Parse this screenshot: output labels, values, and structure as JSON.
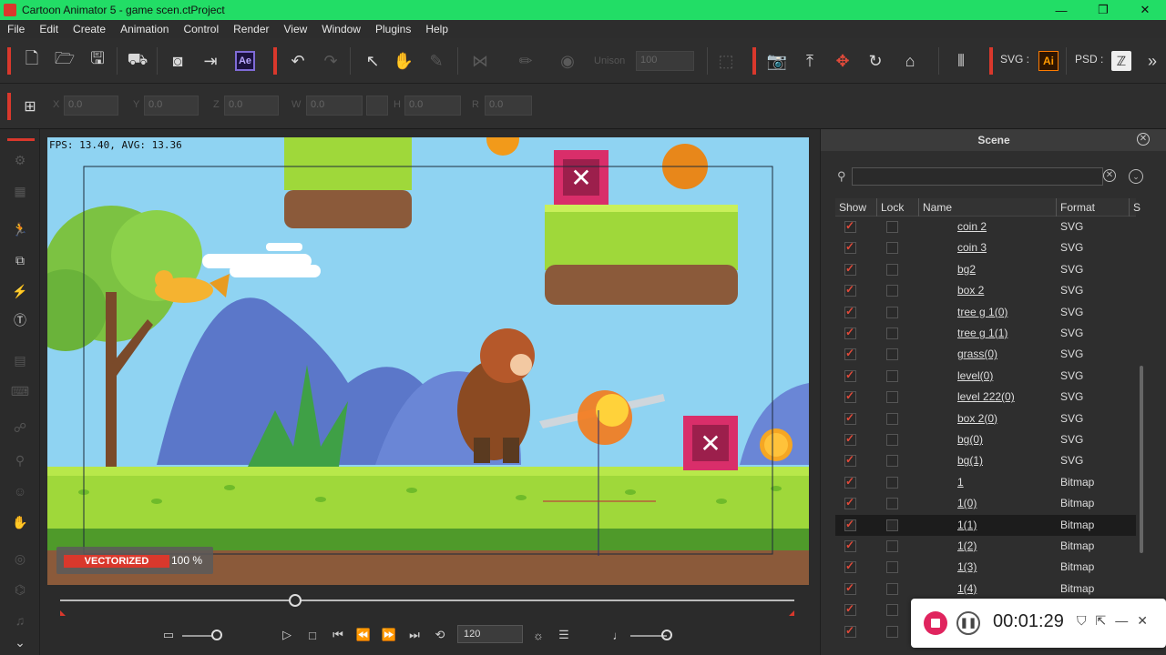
{
  "window": {
    "title": "Cartoon Animator 5 - game scen.ctProject",
    "minimize": "—",
    "restore": "❐",
    "close": "✕"
  },
  "menu": [
    "File",
    "Edit",
    "Create",
    "Animation",
    "Control",
    "Render",
    "View",
    "Window",
    "Plugins",
    "Help"
  ],
  "toolbar": {
    "ae_label": "Ae",
    "svg_label": "SVG :",
    "ai_label": "Ai",
    "psd_label": "PSD :",
    "unison_label": "Unison",
    "unison_value": "100",
    "more": "»"
  },
  "transform": {
    "x_label": "X",
    "x_value": "0.0",
    "y_label": "Y",
    "y_value": "0.0",
    "z_label": "Z",
    "z_value": "0.0",
    "w_label": "W",
    "w_value": "0.0",
    "h_label": "H",
    "h_value": "0.0",
    "r_label": "R",
    "r_value": "0.0"
  },
  "viewport": {
    "fps_text": "FPS: 13.40, AVG: 13.36",
    "vectorized_label": "VECTORIZED",
    "vectorized_percent": "100 %",
    "vectorized_progress": 1.0
  },
  "timeline": {
    "frames": "120",
    "playhead_fraction": 0.32
  },
  "scene_panel": {
    "title": "Scene",
    "search_placeholder": "",
    "columns": {
      "show": "Show",
      "lock": "Lock",
      "name": "Name",
      "format": "Format",
      "extra": "S"
    },
    "rows": [
      {
        "name": "coin 2",
        "format": "SVG",
        "show": true,
        "selected": false
      },
      {
        "name": "coin 3",
        "format": "SVG",
        "show": true,
        "selected": false
      },
      {
        "name": "bg2",
        "format": "SVG",
        "show": true,
        "selected": false
      },
      {
        "name": "box 2",
        "format": "SVG",
        "show": true,
        "selected": false
      },
      {
        "name": "tree g 1(0)",
        "format": "SVG",
        "show": true,
        "selected": false
      },
      {
        "name": "tree g 1(1)",
        "format": "SVG",
        "show": true,
        "selected": false
      },
      {
        "name": "grass(0)",
        "format": "SVG",
        "show": true,
        "selected": false
      },
      {
        "name": "level(0)",
        "format": "SVG",
        "show": true,
        "selected": false
      },
      {
        "name": "level 222(0)",
        "format": "SVG",
        "show": true,
        "selected": false
      },
      {
        "name": "box 2(0)",
        "format": "SVG",
        "show": true,
        "selected": false
      },
      {
        "name": "bg(0)",
        "format": "SVG",
        "show": true,
        "selected": false
      },
      {
        "name": "bg(1)",
        "format": "SVG",
        "show": true,
        "selected": false
      },
      {
        "name": "1",
        "format": "Bitmap",
        "show": true,
        "selected": false
      },
      {
        "name": "1(0)",
        "format": "Bitmap",
        "show": true,
        "selected": false
      },
      {
        "name": "1(1)",
        "format": "Bitmap",
        "show": true,
        "selected": true
      },
      {
        "name": "1(2)",
        "format": "Bitmap",
        "show": true,
        "selected": false
      },
      {
        "name": "1(3)",
        "format": "Bitmap",
        "show": true,
        "selected": false
      },
      {
        "name": "1(4)",
        "format": "Bitmap",
        "show": true,
        "selected": false
      },
      {
        "name": "",
        "format": "",
        "show": true,
        "selected": false
      },
      {
        "name": "",
        "format": "",
        "show": true,
        "selected": false
      }
    ]
  },
  "recorder": {
    "time": "00:01:29"
  },
  "colors": {
    "accent": "#d9382c",
    "title_bar": "#22dd66",
    "check": "#e14a3a"
  }
}
